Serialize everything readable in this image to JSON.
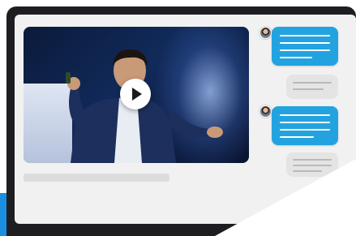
{
  "app": {
    "accent_color": "#1c8fe0",
    "frame_color": "#1e1e22",
    "screen_color": "#f1f1f1"
  },
  "video": {
    "thumbnail": "speaker-on-stage",
    "play_icon": "play-icon",
    "caption_placeholder": "grey-bar"
  },
  "chat": {
    "avatar_icon": "user-avatar-icon",
    "incoming_color": "#22a3e0",
    "outgoing_color": "#e4e4e4",
    "messages": [
      {
        "type": "incoming",
        "lines": 4
      },
      {
        "type": "outgoing",
        "lines": 2
      },
      {
        "type": "incoming",
        "lines": 4
      },
      {
        "type": "outgoing",
        "lines": 3
      }
    ]
  }
}
